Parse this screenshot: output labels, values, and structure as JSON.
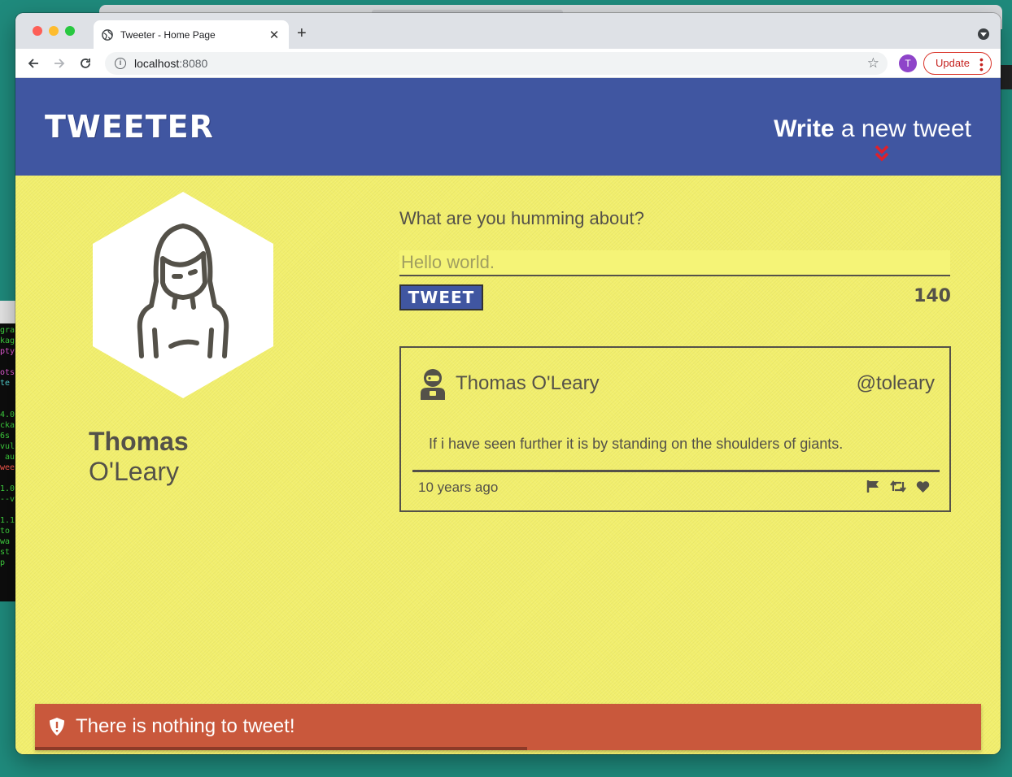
{
  "browser": {
    "tab_title": "Tweeter - Home Page",
    "tab_close": "✕",
    "new_tab": "+",
    "url_host": "localhost",
    "url_port": ":8080",
    "profile_initial": "T",
    "update_label": "Update"
  },
  "header": {
    "brand": "TWEETER",
    "compose_bold": "Write",
    "compose_rest": " a new tweet"
  },
  "profile": {
    "first_name": "Thomas",
    "last_name": " O'Leary"
  },
  "composer": {
    "label": "What are you humming about?",
    "placeholder": "Hello world.",
    "button": "TWEET",
    "counter": "140"
  },
  "tweets": [
    {
      "name": "Thomas O'Leary",
      "handle": "@toleary",
      "text": "If i have seen further it is by standing on the shoulders of giants.",
      "time": "10 years ago"
    }
  ],
  "alert": {
    "message": "There is nothing to tweet!",
    "progress": 0.52
  },
  "colors": {
    "nav": "#4056a1",
    "page": "#f2ef6e",
    "text": "#545149",
    "alert": "#c9583c",
    "chevron": "#e0202a"
  }
}
